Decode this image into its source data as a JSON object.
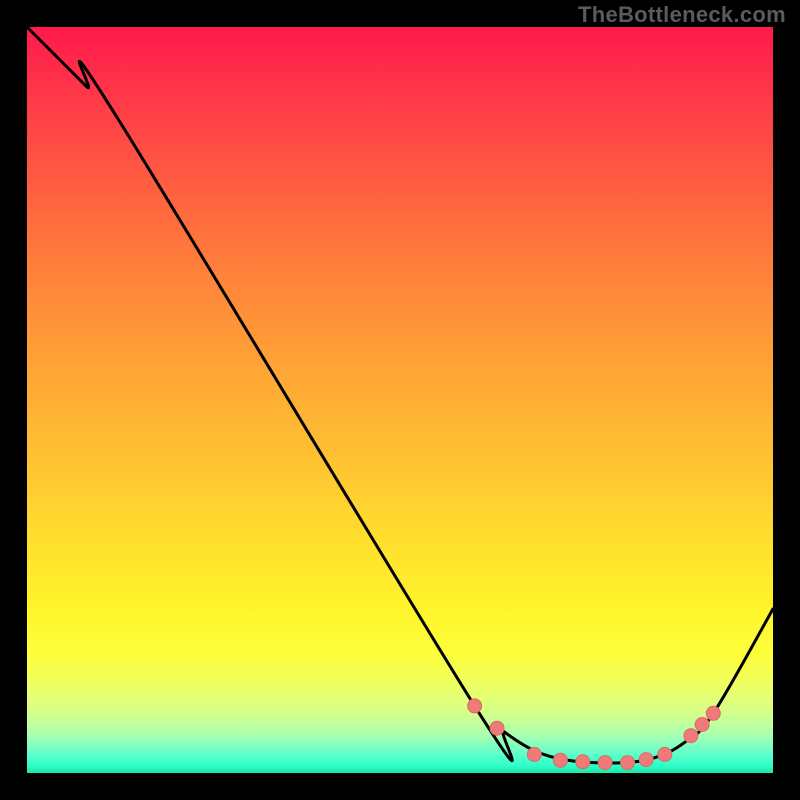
{
  "watermark": "TheBottleneck.com",
  "colors": {
    "frame_background": "#000000",
    "curve_stroke": "#000000",
    "marker_fill": "#ef7a78",
    "marker_stroke": "#d96a68",
    "gradient_top": "#ff1a4b",
    "gradient_bottom": "#18e7a8"
  },
  "chart_data": {
    "type": "line",
    "title": "",
    "xlabel": "",
    "ylabel": "",
    "xlim": [
      0,
      100
    ],
    "ylim": [
      0,
      100
    ],
    "grid": false,
    "legend": false,
    "series": [
      {
        "name": "curve",
        "x": [
          0,
          3,
          8,
          12,
          60,
          64,
          68,
          72,
          76,
          80,
          84,
          88,
          92,
          100
        ],
        "y": [
          100,
          97,
          92,
          88,
          9,
          5.5,
          3.0,
          1.8,
          1.4,
          1.4,
          2.0,
          4.0,
          8.0,
          22
        ]
      }
    ],
    "markers": {
      "name": "highlighted-points",
      "x": [
        60,
        63,
        68,
        71.5,
        74.5,
        77.5,
        80.5,
        83.0,
        85.5,
        89.0,
        90.5,
        92.0
      ],
      "y": [
        9.0,
        6.0,
        2.5,
        1.7,
        1.5,
        1.4,
        1.4,
        1.8,
        2.5,
        5.0,
        6.5,
        8.0
      ]
    }
  }
}
